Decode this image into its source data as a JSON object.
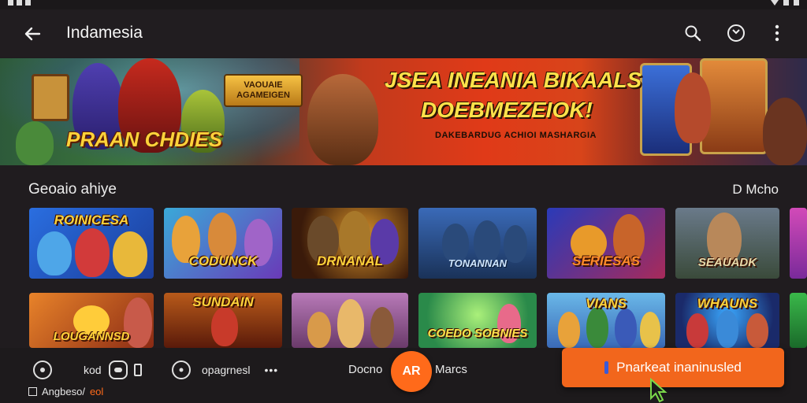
{
  "app": {
    "title": "Indamesia"
  },
  "icons": {
    "back": "back-arrow-icon",
    "search": "search-icon",
    "account": "account-icon",
    "more": "more-vert-icon"
  },
  "banner": {
    "headline1": "JSEA INEANIA BIKAALS",
    "headline2": "DOEBMEZEIOK!",
    "subtitle": "DAKEBARDUG ACHIOI MASHARGIA",
    "logo": "PRAAN CHDIES",
    "badge": "VAOUAIE AGAMEIGEN"
  },
  "section": {
    "title": "Geoaio ahiye",
    "more": "D Mcho"
  },
  "tiles_row1": [
    {
      "label": "ROINICESA"
    },
    {
      "label": "CODUNCK"
    },
    {
      "label": "DRNANAL"
    },
    {
      "label": "TONANNAN"
    },
    {
      "label": "SERIESAS"
    },
    {
      "label": "SEAUADK"
    }
  ],
  "tiles_row2": [
    {
      "label": "LOUGANNSD"
    },
    {
      "label": "SUNDAIN"
    },
    {
      "label": ""
    },
    {
      "label": "COEDO SOBNIES"
    },
    {
      "label": "VIANS"
    },
    {
      "label": "WHAUNS"
    }
  ],
  "bottom": {
    "item1": "kod",
    "item2": "opagrnesl",
    "item3": "Docno",
    "fab": "AR",
    "item4": "Marcs",
    "cta": "Pnarkeat inaninusled",
    "check_left": "Angbeso/",
    "check_right": "eol"
  },
  "colors": {
    "accent": "#f2661c",
    "background": "#201c1f"
  }
}
